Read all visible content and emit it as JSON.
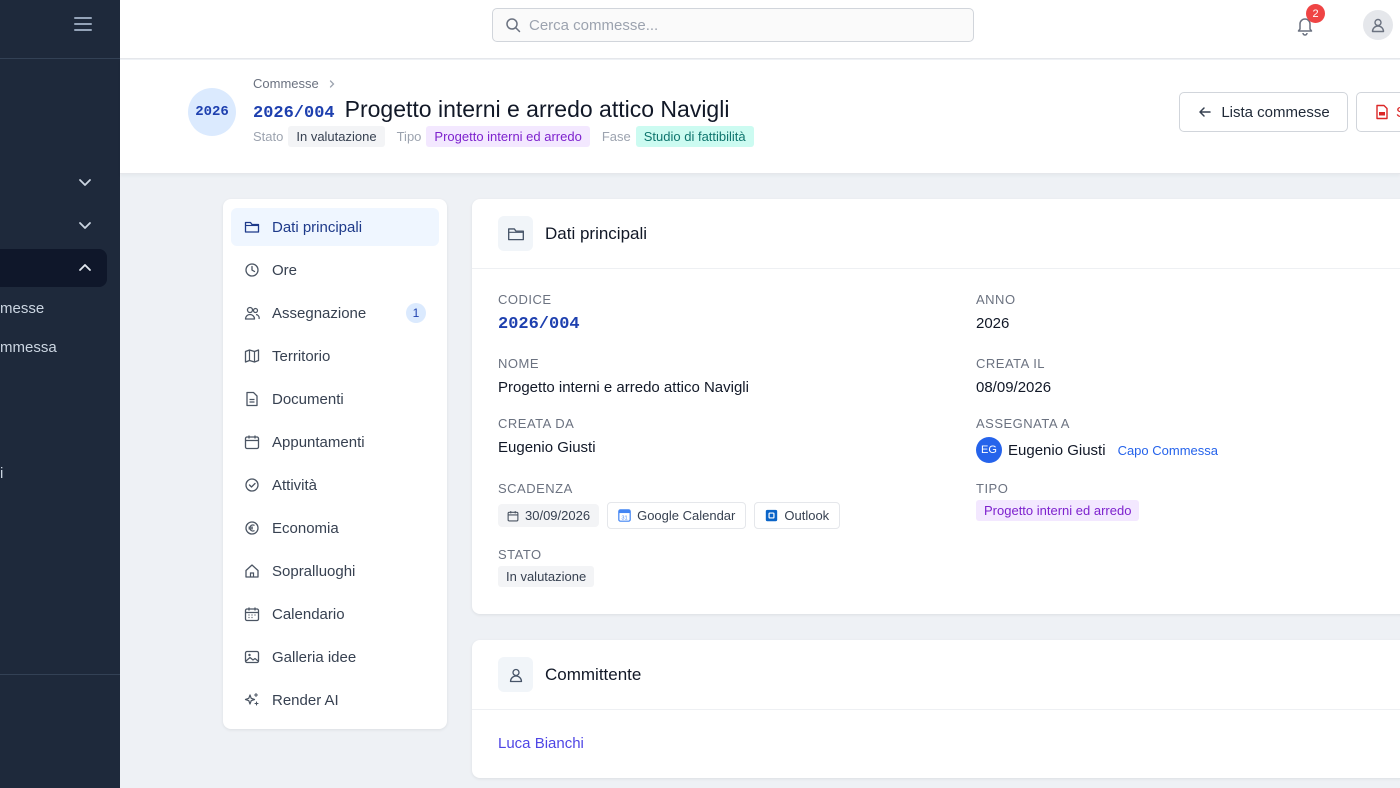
{
  "sidebar": {
    "items": [
      {
        "label": "messe"
      },
      {
        "label": "mmessa"
      },
      {
        "label": "i"
      }
    ]
  },
  "topbar": {
    "search_placeholder": "Cerca commesse...",
    "notifications_count": "2"
  },
  "header": {
    "year_badge": "2026",
    "breadcrumb": "Commesse",
    "code": "2026/004",
    "title": "Progetto interni e arredo attico Navigli",
    "stato_label": "Stato",
    "stato_value": "In valutazione",
    "tipo_label": "Tipo",
    "tipo_value": "Progetto interni ed arredo",
    "fase_label": "Fase",
    "fase_value": "Studio di fattibilità",
    "back_button": "Lista commesse",
    "pdf_button": "S"
  },
  "menu": {
    "items": [
      {
        "label": "Dati principali",
        "icon": "folder-icon"
      },
      {
        "label": "Ore",
        "icon": "clock-icon"
      },
      {
        "label": "Assegnazione",
        "icon": "users-icon",
        "badge": "1"
      },
      {
        "label": "Territorio",
        "icon": "map-icon"
      },
      {
        "label": "Documenti",
        "icon": "document-icon"
      },
      {
        "label": "Appuntamenti",
        "icon": "calendar-icon"
      },
      {
        "label": "Attività",
        "icon": "check-circle-icon"
      },
      {
        "label": "Economia",
        "icon": "euro-icon"
      },
      {
        "label": "Sopralluoghi",
        "icon": "home-icon"
      },
      {
        "label": "Calendario",
        "icon": "calendar-grid-icon"
      },
      {
        "label": "Galleria idee",
        "icon": "image-icon"
      },
      {
        "label": "Render AI",
        "icon": "sparkles-icon"
      }
    ]
  },
  "dati": {
    "title": "Dati principali",
    "codice_label": "Codice",
    "codice_value": "2026/004",
    "anno_label": "Anno",
    "anno_value": "2026",
    "nome_label": "Nome",
    "nome_value": "Progetto interni e arredo attico Navigli",
    "creata_il_label": "Creata il",
    "creata_il_value": "08/09/2026",
    "creata_da_label": "Creata da",
    "creata_da_value": "Eugenio Giusti",
    "assegnata_label": "Assegnata a",
    "assegnata_initials": "EG",
    "assegnata_name": "Eugenio Giusti",
    "assegnata_role": "Capo Commessa",
    "scadenza_label": "Scadenza",
    "scadenza_value": "30/09/2026",
    "google_label": "Google Calendar",
    "outlook_label": "Outlook",
    "tipo_label": "Tipo",
    "tipo_value": "Progetto interni ed arredo",
    "stato_label": "Stato",
    "stato_value": "In valutazione"
  },
  "committente": {
    "title": "Committente",
    "name": "Luca Bianchi"
  }
}
